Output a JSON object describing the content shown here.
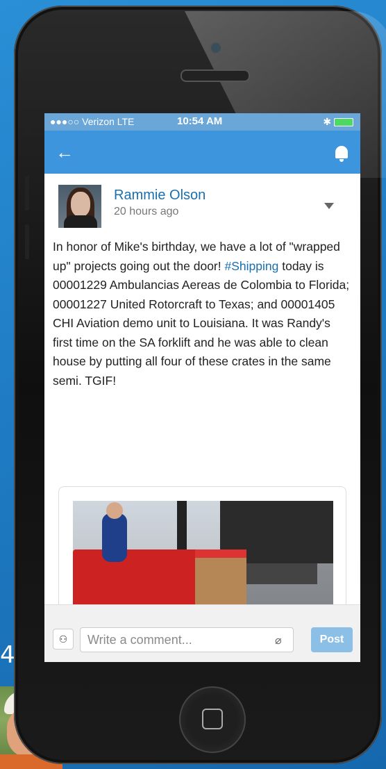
{
  "background": {
    "side_number": "4.",
    "accent_color": "#1f7cc4"
  },
  "status_bar": {
    "carrier": "●●●○○ Verizon  LTE",
    "time": "10:54 AM",
    "right": "✱"
  },
  "nav": {
    "back_icon": "←",
    "bell_icon": "bell-icon"
  },
  "post": {
    "author": "Rammie Olson",
    "timestamp": "20 hours ago",
    "text_before_tag": "In honor of Mike's birthday, we have a lot of \"wrapped up\" projects going out the door! ",
    "hashtag": "#Shipping",
    "text_after_tag": " today is 00001229 Ambulancias Aereas de Colombia to Florida; 00001227 United Rotorcraft to Texas; and 00001405 CHI Aviation demo unit to Louisiana.  It was Randy's first time on the SA forklift and he was able to clean house by putting all four of these crates in the same semi.  TGIF!"
  },
  "comment": {
    "placeholder": "Write a comment...",
    "post_label": "Post",
    "attach_icon": "⌀",
    "mention_icon": "⚇"
  }
}
